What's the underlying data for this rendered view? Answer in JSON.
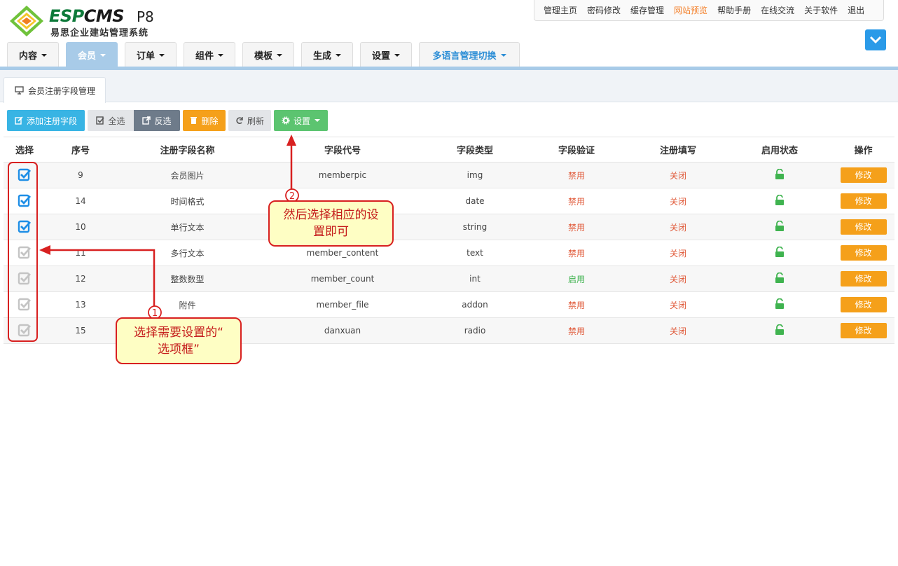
{
  "brand": {
    "word_a": "ESP",
    "word_b": "CMS",
    "version": "P8",
    "subtitle": "易思企业建站管理系统",
    "colors": {
      "green": "#0e7a3a",
      "orange": "#f5a01a",
      "blue": "#2a9ae8"
    }
  },
  "topbar": {
    "links": [
      "管理主页",
      "密码修改",
      "缓存管理",
      "网站预览",
      "帮助手册",
      "在线交流",
      "关于软件",
      "退出"
    ],
    "highlight_color": "#f47f28"
  },
  "nav": {
    "items": [
      {
        "label": "内容"
      },
      {
        "label": "会员"
      },
      {
        "label": "订单"
      },
      {
        "label": "组件"
      },
      {
        "label": "模板"
      },
      {
        "label": "生成"
      },
      {
        "label": "设置"
      },
      {
        "label": "多语言管理切换"
      }
    ],
    "active_color": "#a8cbe8"
  },
  "page_tab": {
    "label": "会员注册字段管理",
    "icon": "monitor-icon"
  },
  "toolbar": {
    "add": "添加注册字段",
    "select_all": "全选",
    "invert": "反选",
    "delete": "删除",
    "refresh": "刷新",
    "settings": "设置"
  },
  "table": {
    "headers": [
      "选择",
      "序号",
      "注册字段名称",
      "字段代号",
      "字段类型",
      "字段验证",
      "注册填写",
      "启用状态",
      "操作"
    ],
    "rows": [
      {
        "checked": true,
        "id": "9",
        "name": "会员图片",
        "code": "memberpic",
        "type": "img",
        "validate": "禁用",
        "register": "关闭",
        "edit": "修改"
      },
      {
        "checked": true,
        "id": "14",
        "name": "时间格式",
        "code": "",
        "type": "date",
        "validate": "禁用",
        "register": "关闭",
        "edit": "修改"
      },
      {
        "checked": true,
        "id": "10",
        "name": "单行文本",
        "code": "",
        "type": "string",
        "validate": "禁用",
        "register": "关闭",
        "edit": "修改"
      },
      {
        "checked": false,
        "id": "11",
        "name": "多行文本",
        "code": "member_content",
        "type": "text",
        "validate": "禁用",
        "register": "关闭",
        "edit": "修改"
      },
      {
        "checked": false,
        "id": "12",
        "name": "整数数型",
        "code": "member_count",
        "type": "int",
        "validate": "启用",
        "register": "关闭",
        "edit": "修改"
      },
      {
        "checked": false,
        "id": "13",
        "name": "附件",
        "code": "member_file",
        "type": "addon",
        "validate": "禁用",
        "register": "关闭",
        "edit": "修改"
      },
      {
        "checked": false,
        "id": "15",
        "name": "",
        "code": "danxuan",
        "type": "radio",
        "validate": "禁用",
        "register": "关闭",
        "edit": "修改"
      }
    ],
    "status_icon": "unlock-icon",
    "status_color": "#3fb34f",
    "disabled_color": "#e05a3a"
  },
  "annotations": {
    "step1": {
      "num": "1",
      "text_line1": "选择需要设置的“",
      "text_line2": "选项框”"
    },
    "step2": {
      "num": "2",
      "text_line1": "然后选择相应的设",
      "text_line2": "置即可"
    },
    "color": "#d82020"
  }
}
